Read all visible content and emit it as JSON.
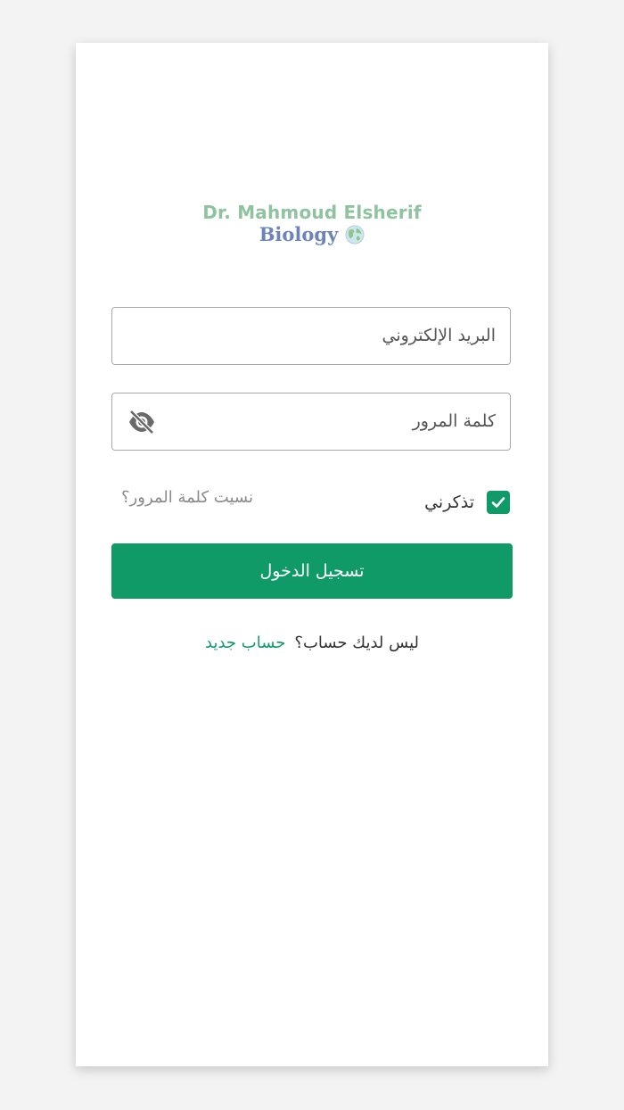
{
  "logo": {
    "line1": "Dr. Mahmoud Elsherif",
    "line2": "Biology",
    "icon": "globe-icon"
  },
  "form": {
    "email_label": "البريد الإلكتروني",
    "password_label": "كلمة المرور",
    "password_toggle_icon": "eye-off-icon",
    "remember_label": "تذكرني",
    "remember_checked": true,
    "forgot_label": "نسيت كلمة المرور؟",
    "submit_label": "تسجيل الدخول"
  },
  "signup": {
    "prompt": "ليس لديك حساب؟",
    "link_label": "حساب جديد"
  },
  "colors": {
    "accent": "#0f9a68",
    "logo_green": "#8fc3a0",
    "logo_blue": "#6c84b8",
    "page_bg": "#f3f3f3"
  }
}
